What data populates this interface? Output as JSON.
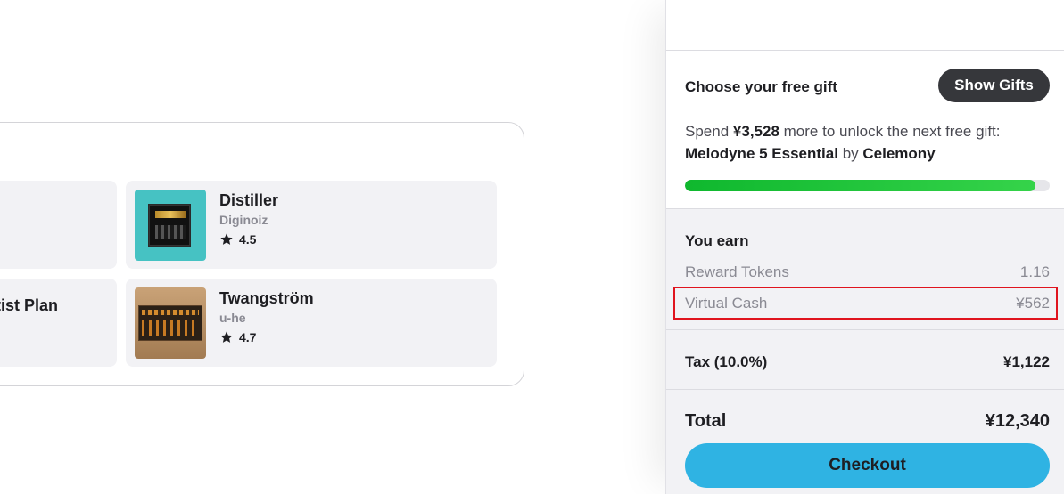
{
  "recommendations": {
    "partial_items": [
      {
        "title": ""
      },
      {
        "title": "rtist Plan"
      }
    ],
    "items": [
      {
        "name": "Distiller",
        "vendor": "Diginoiz",
        "rating": "4.5",
        "thumb_icon": "distiller-plugin-thumbnail"
      },
      {
        "name": "Twangström",
        "vendor": "u-he",
        "rating": "4.7",
        "thumb_icon": "twangstrom-plugin-thumbnail"
      }
    ]
  },
  "gift": {
    "title": "Choose your free gift",
    "show_button": "Show Gifts",
    "spend_prefix": "Spend",
    "spend_amount": "¥3,528",
    "spend_suffix": "more to unlock the next free gift:",
    "gift_product": "Melodyne 5 Essential",
    "by": "by",
    "gift_vendor": "Celemony",
    "progress_fraction": 0.96
  },
  "earn": {
    "title": "You earn",
    "rows": [
      {
        "label": "Reward Tokens",
        "value": "1.16"
      },
      {
        "label": "Virtual Cash",
        "value": "¥562"
      }
    ]
  },
  "tax": {
    "label": "Tax (10.0%)",
    "value": "¥1,122"
  },
  "total": {
    "label": "Total",
    "value": "¥12,340"
  },
  "checkout": {
    "label": "Checkout"
  },
  "colors": {
    "accent_button": "#2fb3e3",
    "progress": "#0fb82e",
    "highlight": "#e0141e",
    "dark_button": "#36373b"
  }
}
